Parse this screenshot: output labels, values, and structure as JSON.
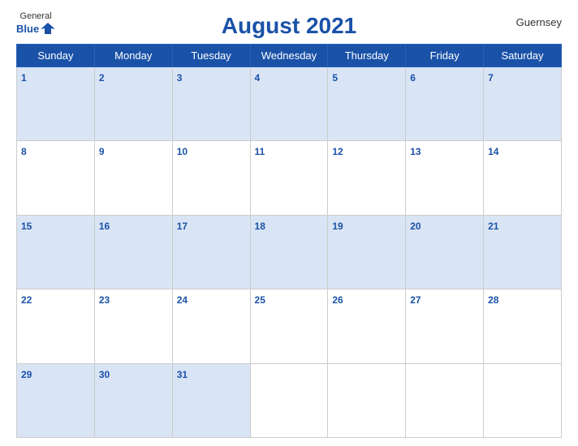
{
  "header": {
    "logo_general": "General",
    "logo_blue": "Blue",
    "title": "August 2021",
    "country": "Guernsey"
  },
  "days_of_week": [
    "Sunday",
    "Monday",
    "Tuesday",
    "Wednesday",
    "Thursday",
    "Friday",
    "Saturday"
  ],
  "weeks": [
    [
      1,
      2,
      3,
      4,
      5,
      6,
      7
    ],
    [
      8,
      9,
      10,
      11,
      12,
      13,
      14
    ],
    [
      15,
      16,
      17,
      18,
      19,
      20,
      21
    ],
    [
      22,
      23,
      24,
      25,
      26,
      27,
      28
    ],
    [
      29,
      30,
      31,
      null,
      null,
      null,
      null
    ]
  ]
}
